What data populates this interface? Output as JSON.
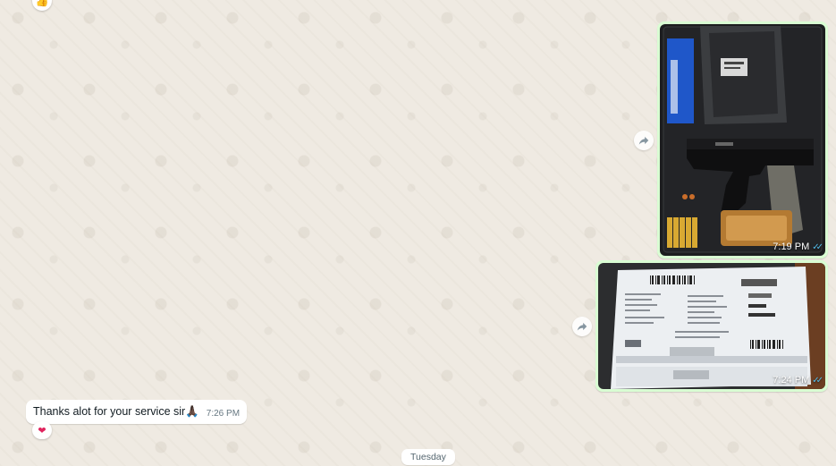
{
  "chat": {
    "top_reaction": {
      "icon": "thumbs-up-icon",
      "glyph": "👍"
    },
    "messages": [
      {
        "id": "photo-1",
        "direction": "outgoing",
        "type": "image",
        "image_description_icon": "pistol-case-photo",
        "time": "7:19 PM",
        "status": "read"
      },
      {
        "id": "photo-2",
        "direction": "outgoing",
        "type": "image",
        "image_description_icon": "shipping-label-photo",
        "time": "7:24 PM",
        "status": "read"
      },
      {
        "id": "text-1",
        "direction": "incoming",
        "type": "text",
        "text": "Thanks alot for your service sir",
        "emoji": "🙏🏿",
        "time": "7:26 PM",
        "reaction": "❤"
      }
    ],
    "day_divider": "Tuesday"
  },
  "colors": {
    "background": "#efeae2",
    "outgoing_bubble": "#d9fdd3",
    "read_ticks": "#53bdeb"
  }
}
